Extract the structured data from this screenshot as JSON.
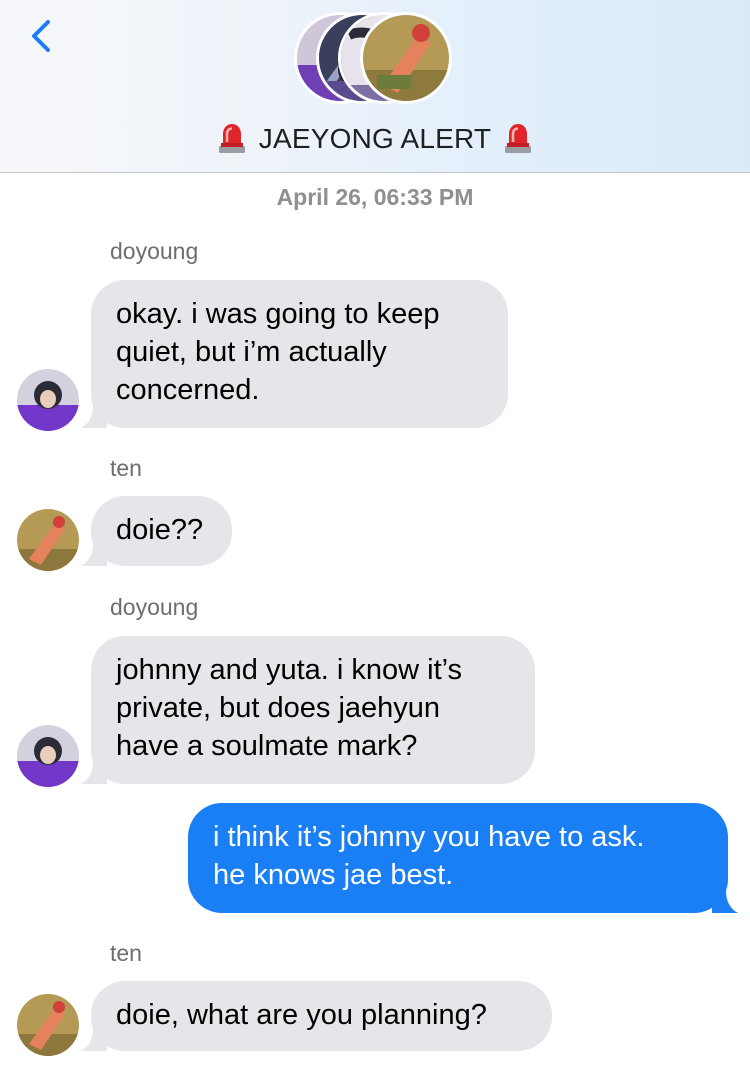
{
  "header": {
    "back_icon": "chevron-left-icon",
    "title": "JAEYONG ALERT",
    "title_emoji_icon": "police-siren-icon",
    "accent_color": "#1a7ff5"
  },
  "timestamp": "April 26, 06:33 PM",
  "messages": [
    {
      "sender": "doyoung",
      "direction": "incoming",
      "lines": [
        "okay. i was going to keep",
        "quiet, but i’m actually",
        "concerned."
      ]
    },
    {
      "sender": "ten",
      "direction": "incoming",
      "lines": [
        "doie??"
      ]
    },
    {
      "sender": "doyoung",
      "direction": "incoming",
      "lines": [
        "johnny and yuta. i know it’s",
        "private, but does jaehyun",
        "have a soulmate mark?"
      ]
    },
    {
      "sender": "",
      "direction": "outgoing",
      "lines": [
        "i think it’s johnny you have to ask.",
        "he knows jae best."
      ]
    },
    {
      "sender": "ten",
      "direction": "incoming",
      "lines": [
        "doie, what are you planning?"
      ]
    }
  ],
  "colors": {
    "incoming_bubble": "#e5e5ea",
    "outgoing_bubble": "#1a7ff5",
    "meta_text": "#8e8e93"
  }
}
